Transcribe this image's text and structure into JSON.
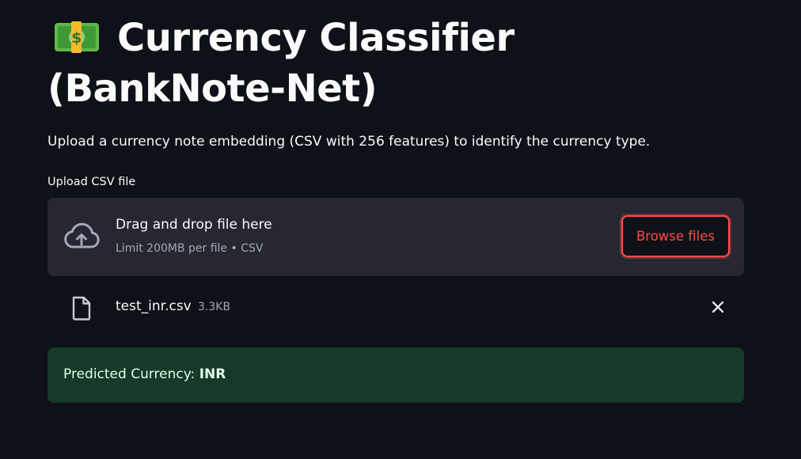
{
  "app": {
    "title": "Currency Classifier (BankNote-Net)",
    "title_icon": "dollar-banknote-emoji",
    "description": "Upload a currency note embedding (CSV with 256 features) to identify the currency type."
  },
  "uploader": {
    "label": "Upload CSV file",
    "dropzone_title": "Drag and drop file here",
    "dropzone_limit": "Limit 200MB per file • CSV",
    "browse_label": "Browse files",
    "icon": "cloud-upload-icon"
  },
  "uploaded_file": {
    "name": "test_inr.csv",
    "size": "3.3KB",
    "icon": "file-icon",
    "remove_icon": "close-icon"
  },
  "result": {
    "label": "Predicted Currency: ",
    "value": "INR"
  },
  "colors": {
    "background": "#0e1117",
    "dropzone": "#262730",
    "accent": "#ff4b4b",
    "success_bg": "#173928",
    "success_text": "#dffde9"
  }
}
